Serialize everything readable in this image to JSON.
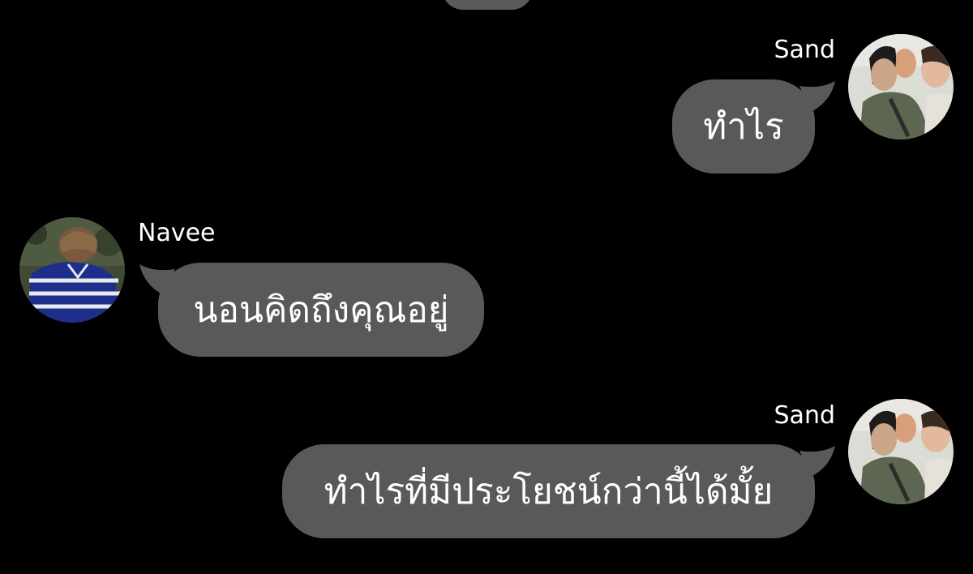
{
  "messages": [
    {
      "side": "right",
      "sender": "Sand",
      "text": "ทำไร",
      "avatar": "sand-avatar"
    },
    {
      "side": "left",
      "sender": "Navee",
      "text": "นอนคิดถึงคุณอยู่",
      "avatar": "navee-avatar"
    },
    {
      "side": "right",
      "sender": "Sand",
      "text": "ทำไรที่มีประโยชน์กว่านี้ได้มั้ย",
      "avatar": "sand-avatar"
    }
  ],
  "colors": {
    "background": "#000000",
    "bubble": "#595959",
    "text": "#ffffff"
  }
}
